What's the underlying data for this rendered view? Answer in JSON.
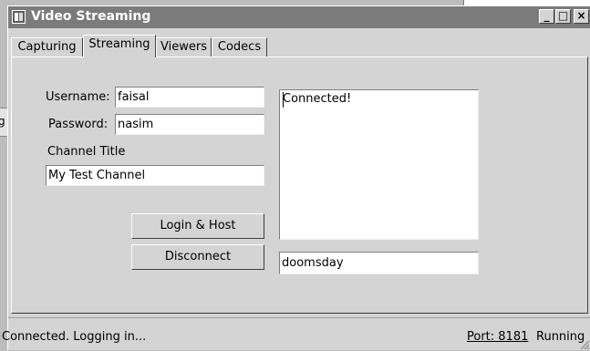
{
  "window": {
    "title": "Video Streaming",
    "buttons": [
      "_",
      "□",
      "×"
    ]
  },
  "background": {
    "left_fragment": "g"
  },
  "tabs": [
    {
      "label": "Capturing",
      "active": false
    },
    {
      "label": "Streaming",
      "active": true
    },
    {
      "label": "Viewers",
      "active": false
    },
    {
      "label": "Codecs",
      "active": false
    }
  ],
  "form": {
    "username_label": "Username:",
    "username_value": "faisal",
    "password_label": "Password:",
    "password_value": "nasim",
    "channel_title_label": "Channel Title",
    "channel_title_value": "My Test Channel",
    "login_button": "Login & Host",
    "disconnect_button": "Disconnect"
  },
  "log": {
    "text": "Connected!",
    "input_value": "doomsday"
  },
  "status": {
    "left_text": "Connected. Logging in...",
    "port_text": "Port: 8181",
    "running_text": "Running"
  },
  "icons": {
    "app": "window-app-icon",
    "grip": "resize-grip-icon"
  }
}
